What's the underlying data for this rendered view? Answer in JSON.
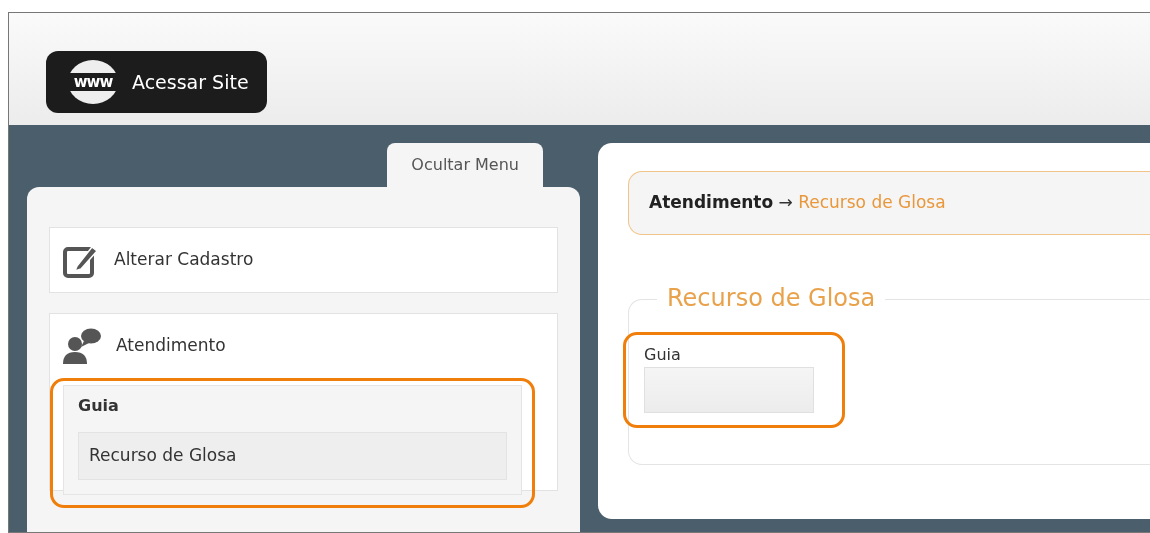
{
  "header": {
    "site_button": {
      "icon_text": "www",
      "label": "Acessar Site"
    }
  },
  "sidebar": {
    "toggle_tab": "Ocultar Menu",
    "items": [
      {
        "label": "Alterar Cadastro",
        "kind": "edit"
      },
      {
        "label": "Atendimento",
        "kind": "support",
        "groups": [
          {
            "title": "Guia",
            "highlighted": true,
            "links": [
              {
                "label": "Recurso de Glosa",
                "selected": true
              }
            ]
          }
        ]
      }
    ]
  },
  "breadcrumb": {
    "parent": "Atendimento",
    "separator": "→",
    "current": "Recurso de Glosa"
  },
  "form": {
    "legend": "Recurso de Glosa",
    "fields": [
      {
        "label": "Guia",
        "highlighted": true
      }
    ]
  }
}
